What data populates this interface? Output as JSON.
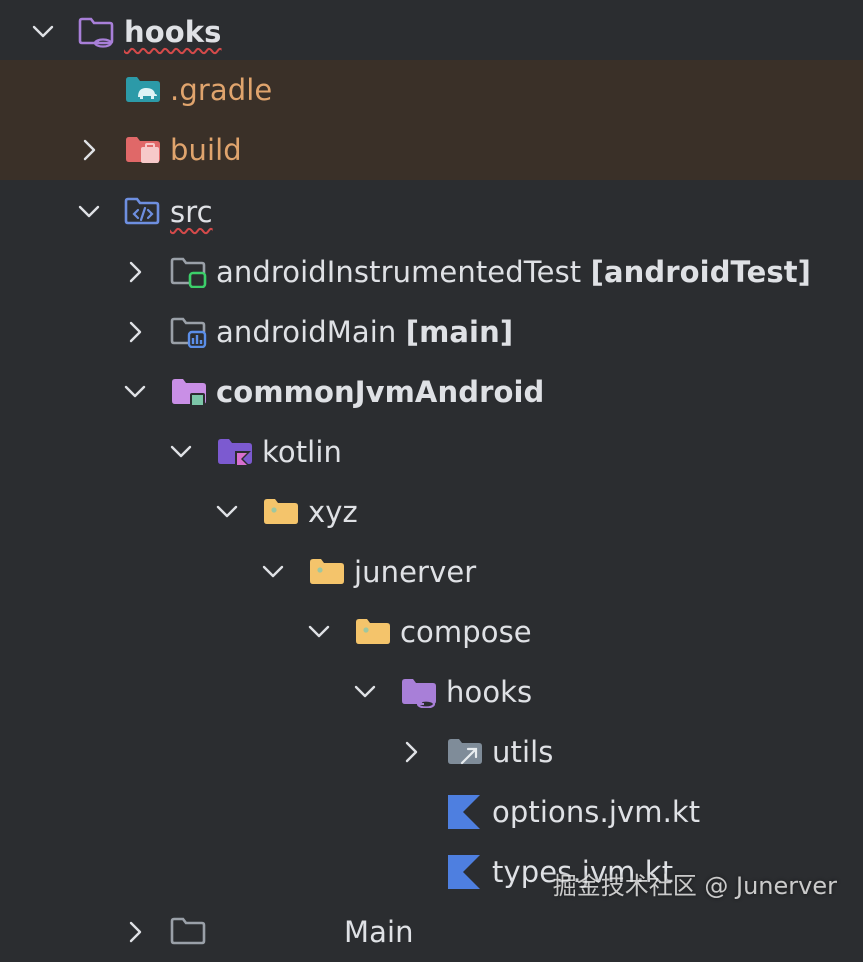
{
  "tree": {
    "root": {
      "label": "hooks"
    },
    "gradle": {
      "label": ".gradle"
    },
    "build": {
      "label": "build"
    },
    "src": {
      "label": "src"
    },
    "android_instrumented_test": {
      "label": "androidInstrumentedTest",
      "tag": "[androidTest]"
    },
    "android_main": {
      "label": "androidMain",
      "tag": "[main]"
    },
    "common_jvm_android": {
      "label": "commonJvmAndroid"
    },
    "kotlin": {
      "label": "kotlin"
    },
    "xyz": {
      "label": "xyz"
    },
    "junerver": {
      "label": "junerver"
    },
    "compose": {
      "label": "compose"
    },
    "hooks_pkg": {
      "label": "hooks"
    },
    "utils": {
      "label": "utils"
    },
    "options_file": {
      "label": "options.jvm.kt"
    },
    "types_file": {
      "label": "types.jvm.kt"
    },
    "partial_next": {
      "label": "Main"
    }
  },
  "watermark": "掘金技术社区 @ Junerver",
  "colors": {
    "background": "#2b2d30",
    "excluded_row": "#3a3028",
    "excluded_text": "#e0a46d",
    "text": "#dfe1e5",
    "folder_yellow": "#f4c46b",
    "module_purple": "#a87fd8",
    "kotlin_blue": "#4e7fe0"
  }
}
